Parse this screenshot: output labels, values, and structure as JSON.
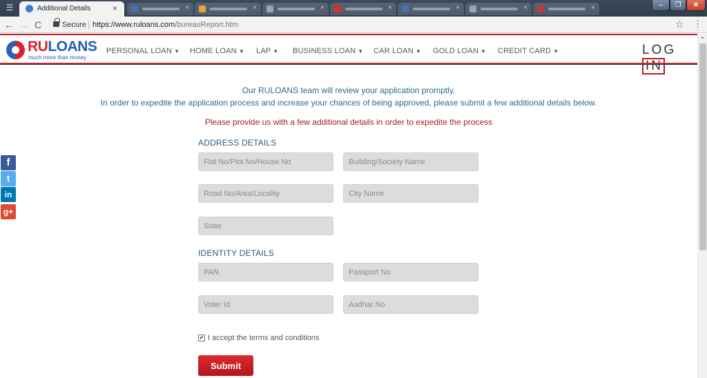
{
  "browser": {
    "active_tab": {
      "title": "Additional Details",
      "close": "×"
    },
    "background_tabs": [
      {
        "fav_color": "#4a6fb0"
      },
      {
        "fav_color": "#e8a33a"
      },
      {
        "fav_color": "#9aa6b4"
      },
      {
        "fav_color": "#d9302c"
      },
      {
        "fav_color": "#4a6fb0"
      },
      {
        "fav_color": "#9aa6b4"
      },
      {
        "fav_color": "#c23a3a"
      }
    ],
    "window_controls": {
      "minimize": "–",
      "maximize": "❐",
      "close": "✕"
    },
    "nav": {
      "back": "←",
      "forward": "→",
      "reload": "C"
    },
    "secure_label": "Secure",
    "url_base": "https://www.ruloans.com",
    "url_path": "/bureauReport.htm"
  },
  "header": {
    "logo_ru": "RU",
    "logo_loans": "LOANS",
    "logo_tagline": "much more than money",
    "nav": [
      {
        "label": "PERSONAL LOAN"
      },
      {
        "label": "HOME LOAN"
      },
      {
        "label": "LAP"
      },
      {
        "label": "BUSINESS LOAN"
      },
      {
        "label": "CAR LOAN"
      },
      {
        "label": "GOLD LOAN"
      },
      {
        "label": "CREDIT CARD"
      }
    ],
    "caret": "▼",
    "login_prefix": "LOG",
    "login_boxed": "IN"
  },
  "content": {
    "intro_line1": "Our RULOANS team will review your application promptly.",
    "intro_line2": "In order to expedite the application process and increase your chances of being approved, please submit a few additional details below.",
    "notice": "Please provide us with a few additional details in order to expedite the process",
    "address": {
      "title": "ADDRESS DETAILS",
      "flat": "Flat No/Plot No/House No",
      "building": "Building/Society Name",
      "road": "Road No/Area/Locality",
      "city": "City Name",
      "state": "State"
    },
    "identity": {
      "title": "IDENTITY DETAILS",
      "pan": "PAN",
      "passport": "Passport No",
      "voter": "Voter Id",
      "aadhar": "Aadhar No"
    },
    "terms_label": "I accept the terms and conditions",
    "terms_check": "✔",
    "submit_label": "Submit"
  },
  "social": {
    "facebook": "f",
    "twitter": "t",
    "linkedin": "in",
    "googleplus": "g+"
  },
  "colors": {
    "brand_red": "#d8232a",
    "brand_blue": "#1f5fb0",
    "info_text": "#2b6a8e",
    "notice_text": "#a31d24"
  }
}
